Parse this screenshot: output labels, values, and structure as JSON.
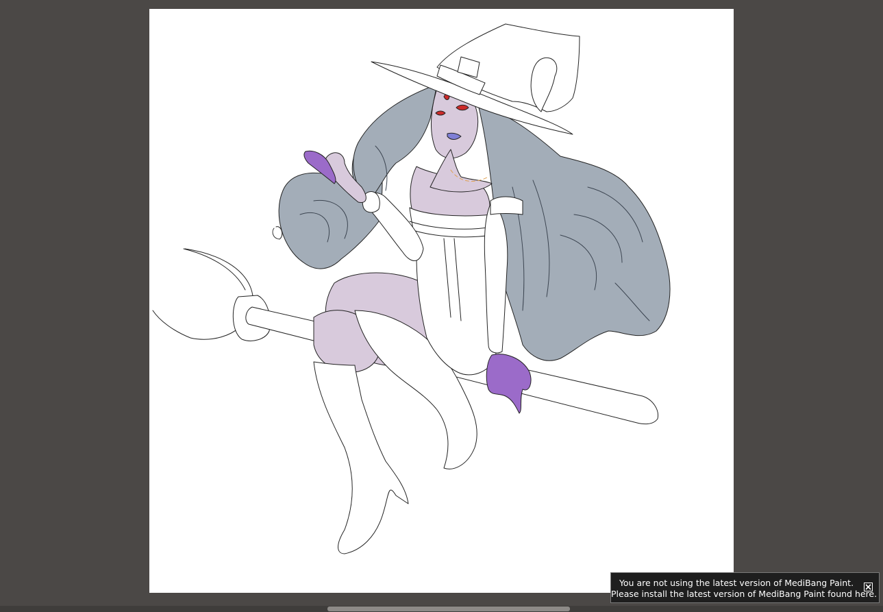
{
  "app": {
    "name": "MediBang Paint"
  },
  "notification": {
    "line1": "You are not using the latest version of MediBang Paint.",
    "line2": "Please install the latest version of MediBang Paint found here.",
    "close_icon": "close-x-icon"
  },
  "artwork": {
    "subject": "witch-on-broom-illustration",
    "colors": {
      "workspace_bg": "#4b4846",
      "canvas_bg": "#ffffff",
      "hair": "#a3adb8",
      "skin": "#d8cadc",
      "gloves": "#9b6bc9",
      "outline": "#222222"
    }
  }
}
